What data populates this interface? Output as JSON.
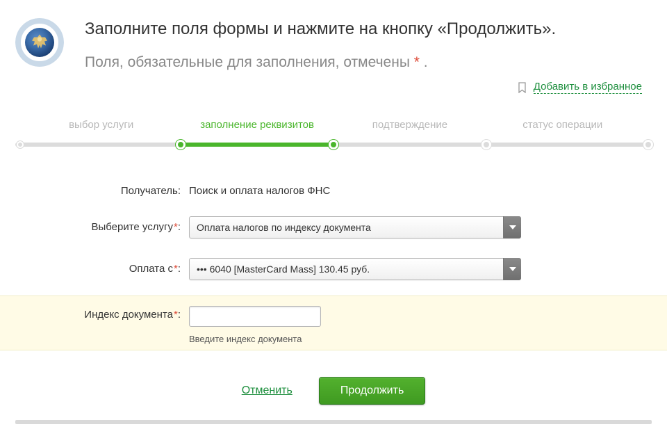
{
  "header": {
    "title": "Заполните поля формы и нажмите на кнопку «Продолжить».",
    "subtitle_prefix": "Поля, обязательные для заполнения, отмечены ",
    "subtitle_suffix": " ."
  },
  "favorites": {
    "label": "Добавить в избранное"
  },
  "stepper": {
    "steps": [
      {
        "label": "выбор услуги",
        "active": false
      },
      {
        "label": "заполнение реквизитов",
        "active": true
      },
      {
        "label": "подтверждение",
        "active": false
      },
      {
        "label": "статус операции",
        "active": false
      }
    ],
    "active_segment_start_pct": 26,
    "active_segment_end_pct": 50
  },
  "form": {
    "receiver": {
      "label": "Получатель:",
      "value": "Поиск и оплата налогов ФНС"
    },
    "service_select": {
      "label": "Выберите услугу",
      "label_colon": ":",
      "value": "Оплата налогов по индексу документа"
    },
    "pay_from": {
      "label": "Оплата с",
      "label_colon": ":",
      "value": "••• 6040 [MasterCard Mass] 130.45 руб."
    },
    "doc_index": {
      "label": "Индекс документа",
      "label_colon": ":",
      "value": "",
      "helper": "Введите индекс документа"
    }
  },
  "actions": {
    "cancel": "Отменить",
    "continue": "Продолжить"
  },
  "colors": {
    "accent_green": "#4ab62c",
    "link_green": "#1e8f3e",
    "required_red": "#dd4b39"
  }
}
